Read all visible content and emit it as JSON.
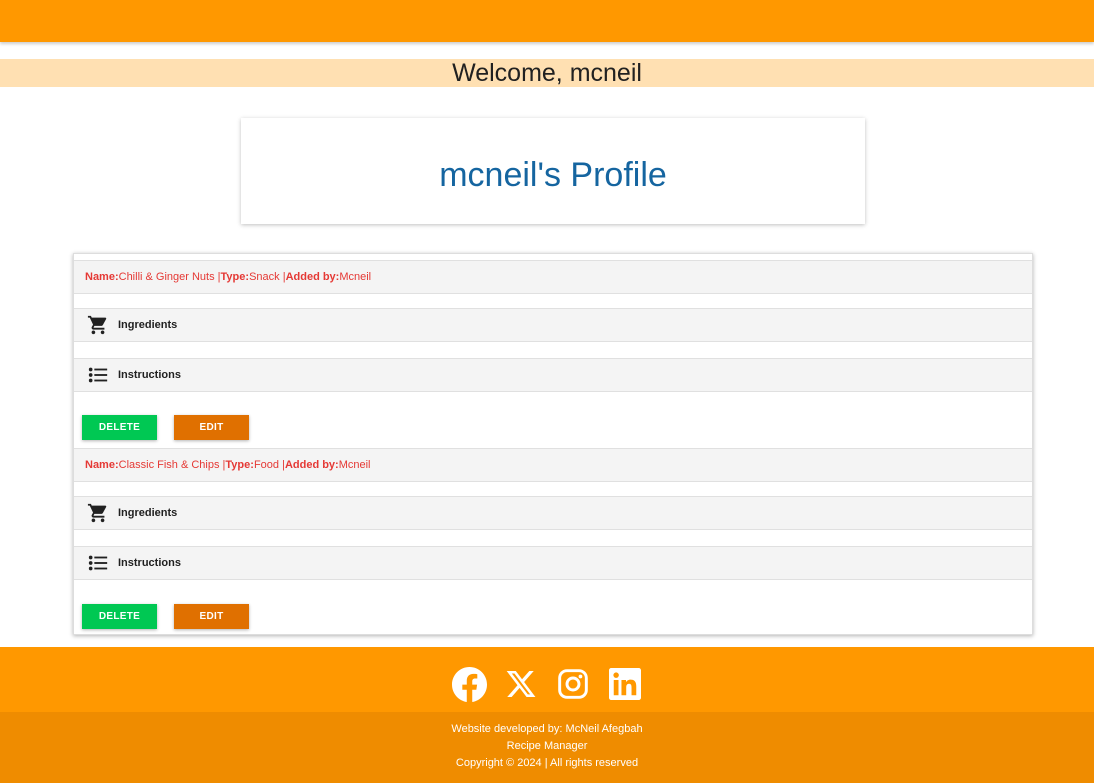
{
  "welcome": "Welcome, mcneil",
  "profile_title": "mcneil's Profile",
  "labels": {
    "name": "Name:",
    "type": "Type:",
    "added_by": "Added by:",
    "ingredients": "Ingredients",
    "instructions": "Instructions",
    "delete": "DELETE",
    "edit": "EDIT"
  },
  "recipes": [
    {
      "name": "Chilli & Ginger Nuts",
      "type": "Snack",
      "added_by": "Mcneil"
    },
    {
      "name": "Classic Fish & Chips",
      "type": "Food",
      "added_by": "Mcneil"
    }
  ],
  "social_icons": [
    "facebook-icon",
    "x-icon",
    "instagram-icon",
    "linkedin-icon"
  ],
  "footer": {
    "developer": "Website developed by: McNeil Afegbah",
    "app": "Recipe Manager",
    "copyright": "Copyright © 2024 | All rights reserved"
  },
  "colors": {
    "accent": "#ff9800",
    "footer_dark": "#ef8c00",
    "delete": "#00c853",
    "edit": "#e07000",
    "title_blue": "#1565a0",
    "meta_red": "#e53935"
  }
}
